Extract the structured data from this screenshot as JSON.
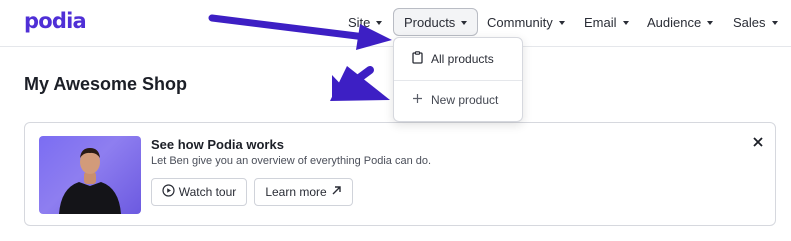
{
  "brand": {
    "logo_text": "podia",
    "logo_color": "#4f2fd6"
  },
  "nav": {
    "items": [
      {
        "label": "Site"
      },
      {
        "label": "Products"
      },
      {
        "label": "Community"
      },
      {
        "label": "Email"
      },
      {
        "label": "Audience"
      },
      {
        "label": "Sales"
      }
    ],
    "active": "Products"
  },
  "dropdown": {
    "items": [
      {
        "label": "All products",
        "icon": "clipboard-icon"
      },
      {
        "label": "New product",
        "icon": "plus-icon"
      }
    ]
  },
  "page": {
    "title": "My Awesome Shop"
  },
  "promo": {
    "title": "See how Podia works",
    "subtitle": "Let Ben give you an overview of everything Podia can do.",
    "watch_label": "Watch tour",
    "learn_label": "Learn more",
    "thumbnail_icon": "presenter-photo-icon"
  },
  "annotation": {
    "arrow_color": "#3d1fc4"
  }
}
